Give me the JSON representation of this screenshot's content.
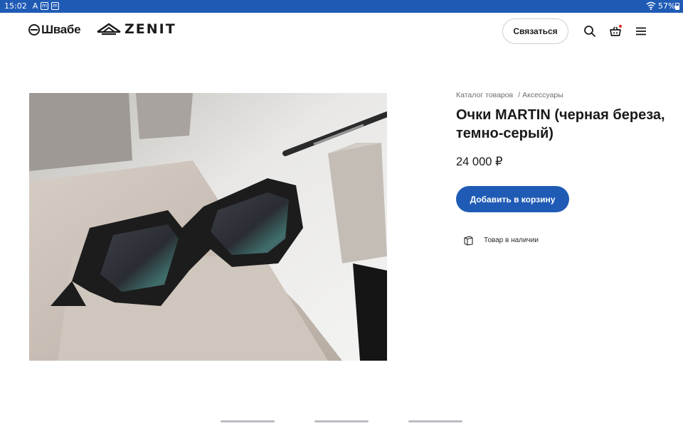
{
  "status_bar": {
    "time": "15:02",
    "notification_icons": [
      "A",
      "m",
      "m"
    ],
    "battery": "57%"
  },
  "header": {
    "logo_shvabe": "Швабе",
    "logo_zenit": "ZENIT",
    "contact_button": "Связаться",
    "icons": [
      "search-icon",
      "cart-icon",
      "menu-icon"
    ]
  },
  "product": {
    "breadcrumb": [
      "Каталог товаров",
      "Аксессуары"
    ],
    "breadcrumb_separator": "/",
    "title": "Очки MARTIN (черная береза, темно-серый)",
    "price": "24 000 ₽",
    "add_to_cart": "Добавить в корзину",
    "stock_status": "Товар в наличии"
  },
  "colors": {
    "accent": "#1f5bb5",
    "cart_badge": "#e0261b"
  }
}
